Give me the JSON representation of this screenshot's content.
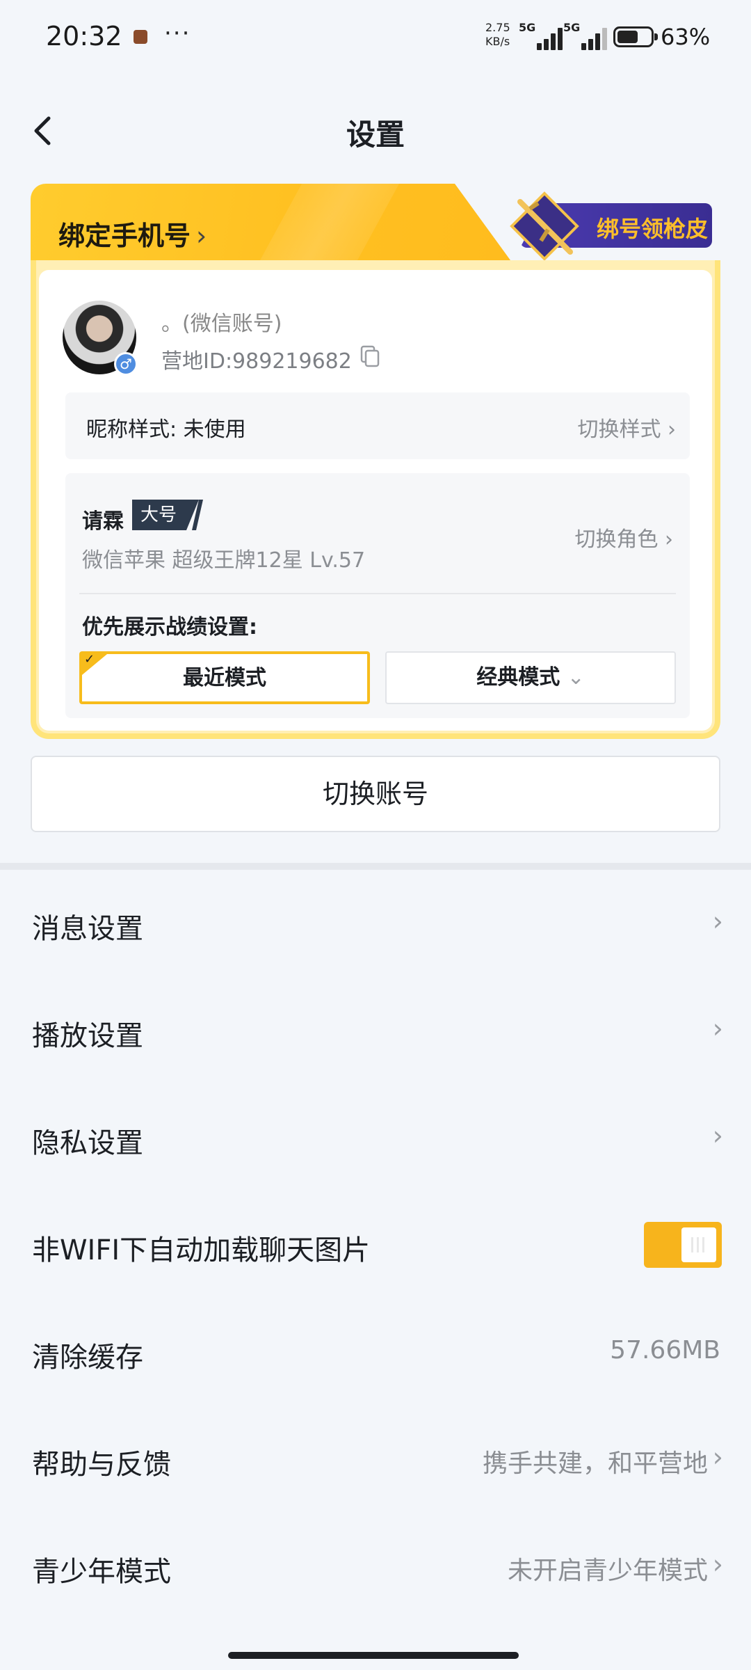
{
  "status_bar": {
    "time": "20:32",
    "dots": "···",
    "net_speed_value": "2.75",
    "net_speed_unit": "KB/s",
    "sim1": "5G",
    "sim2": "5G",
    "battery_level": 0.63,
    "battery_pct": "63%"
  },
  "header": {
    "title": "设置"
  },
  "account_card": {
    "bind_phone_label": "绑定手机号",
    "skin_badge_label": "绑号领枪皮",
    "nickname": "。(微信账号)",
    "camp_id": "营地ID:989219682",
    "nick_style_label": "昵称样式: 未使用",
    "nick_style_action": "切换样式",
    "role_name": "请霖",
    "role_tag": "大号",
    "role_meta": "微信苹果  超级王牌12星  Lv.57",
    "role_action": "切换角色",
    "pref_label": "优先展示战绩设置:",
    "mode_recent": "最近模式",
    "mode_classic": "经典模式"
  },
  "switch_account": "切换账号",
  "settings": [
    {
      "label": "消息设置",
      "value": ""
    },
    {
      "label": "播放设置",
      "value": ""
    },
    {
      "label": "隐私设置",
      "value": ""
    },
    {
      "label": "非WIFI下自动加载聊天图片",
      "toggle_on": true
    },
    {
      "label": "清除缓存",
      "value": "57.66MB"
    },
    {
      "label": "帮助与反馈",
      "value": "携手共建，和平营地"
    },
    {
      "label": "青少年模式",
      "value": "未开启青少年模式"
    }
  ],
  "colors": {
    "accent": "#f7b41c",
    "card_gold": "#ffc021",
    "badge_purple": "#4b3bb0",
    "gender_blue": "#4f8de0"
  }
}
